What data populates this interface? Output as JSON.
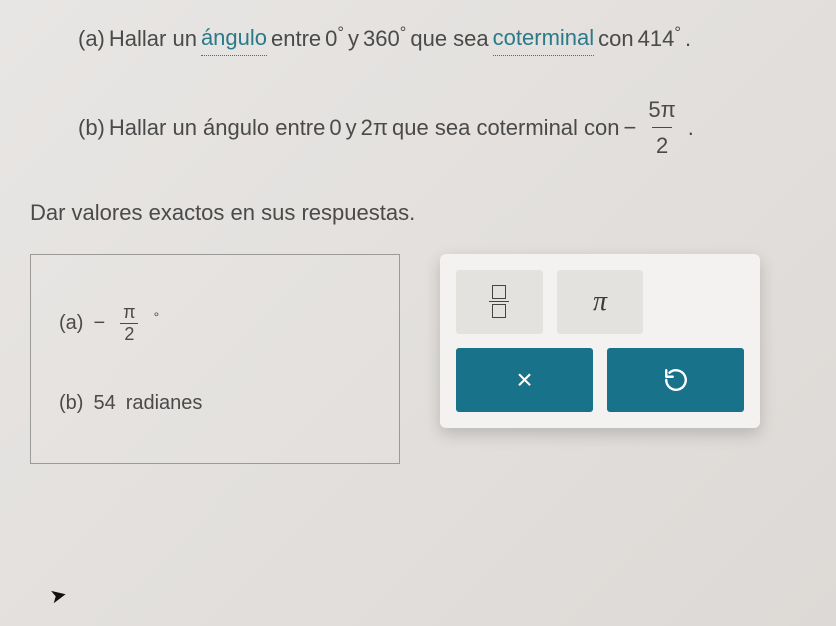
{
  "question_a": {
    "label": "(a)",
    "text1": "Hallar un",
    "link": "ángulo",
    "text2": "entre",
    "val1": "0",
    "deg1": "°",
    "y": "y",
    "val2": "360",
    "deg2": "°",
    "text3": "que sea",
    "link2": "coterminal",
    "text4": "con",
    "val3": "414",
    "deg3": "°",
    "period": "."
  },
  "question_b": {
    "label": "(b)",
    "text1": "Hallar un ángulo entre",
    "val1": "0",
    "y": "y",
    "val2": "2π",
    "text2": "que sea coterminal con",
    "minus": "−",
    "frac_num": "5π",
    "frac_den": "2",
    "period": "."
  },
  "instruction": "Dar valores exactos en sus respuestas.",
  "answers": {
    "a": {
      "label": "(a)",
      "minus": "−",
      "num": "π",
      "den": "2",
      "unit": "°"
    },
    "b": {
      "label": "(b)",
      "value": "54",
      "unit": "radianes"
    }
  },
  "tools": {
    "fraction": "fraction",
    "pi": "π",
    "close": "×",
    "undo": "↺"
  }
}
